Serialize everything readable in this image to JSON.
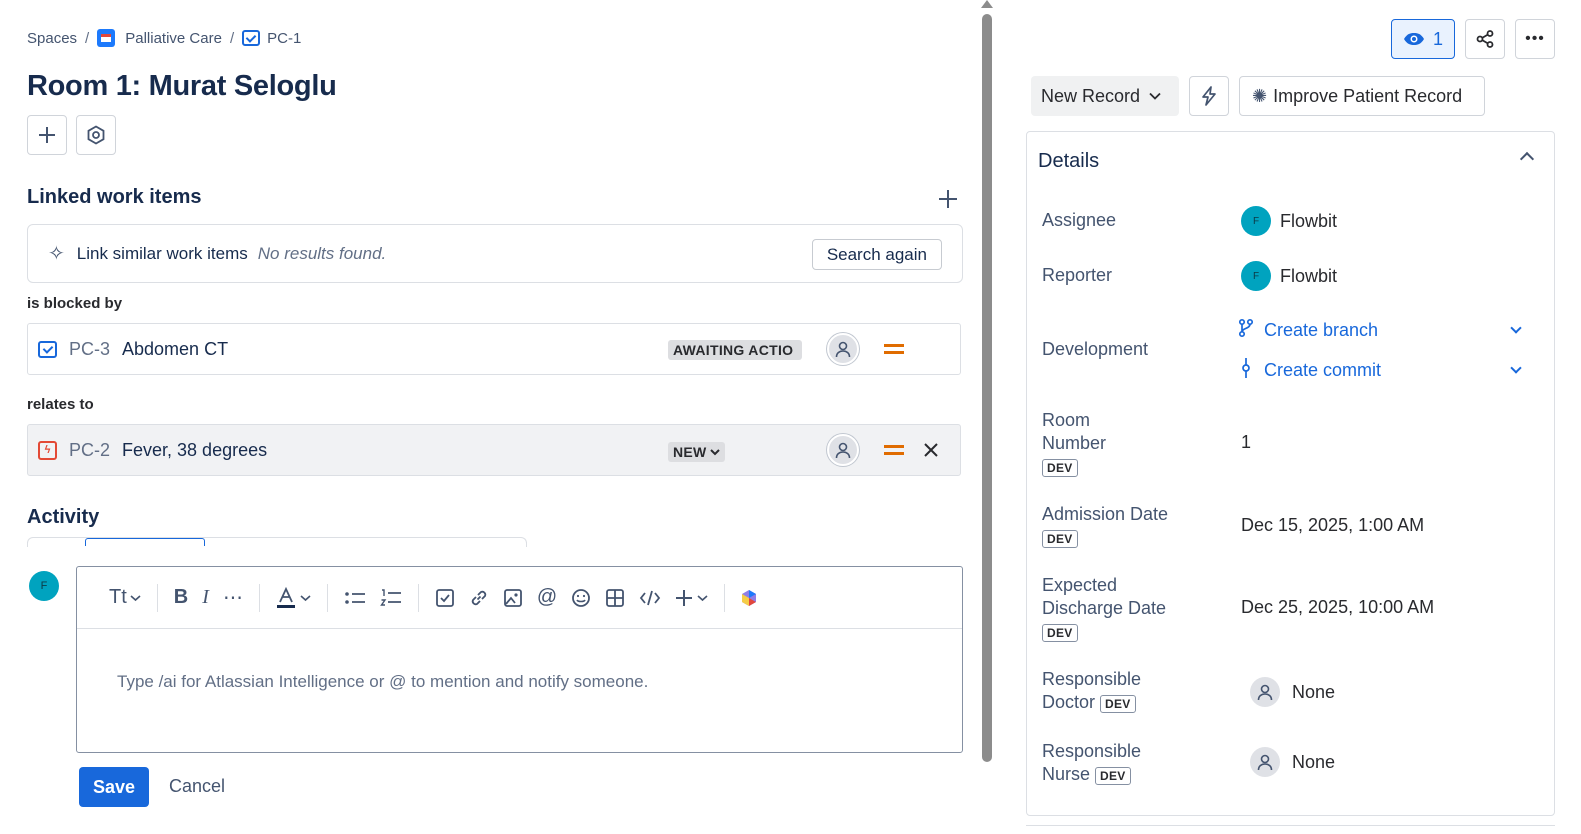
{
  "breadcrumb": {
    "spaces": "Spaces",
    "space_name": "Palliative Care",
    "issue_key": "PC-1",
    "separator": "/"
  },
  "issue": {
    "title": "Room 1: Murat Seloglu"
  },
  "linked": {
    "heading": "Linked work items",
    "suggest_label": "Link similar work items",
    "no_results": "No results found.",
    "search_again": "Search again",
    "groups": [
      {
        "relation": "is blocked by",
        "key": "PC-3",
        "summary": "Abdomen CT",
        "status": "AWAITING ACTIO"
      },
      {
        "relation": "relates to",
        "key": "PC-2",
        "summary": "Fever, 38 degrees",
        "status": "NEW"
      }
    ],
    "bug_glyph": "ϟ"
  },
  "activity": {
    "heading": "Activity",
    "avatar_initial": "F",
    "placeholder": "Type /ai for Atlassian Intelligence or @ to mention and notify someone.",
    "save": "Save",
    "cancel": "Cancel",
    "toolbar_text_style": "Tt"
  },
  "header": {
    "watch_count": "1",
    "status": "New Record",
    "improve": "Improve Patient Record"
  },
  "details": {
    "heading": "Details",
    "badge": "DEV",
    "assignee_label": "Assignee",
    "assignee": "Flowbit",
    "reporter_label": "Reporter",
    "reporter": "Flowbit",
    "user_initial": "F",
    "development_label": "Development",
    "create_branch": "Create branch",
    "create_commit": "Create commit",
    "room_label_1": "Room",
    "room_label_2": "Number",
    "room_value": "1",
    "admission_label": "Admission Date",
    "admission_value": "Dec 15, 2025, 1:00 AM",
    "discharge_label_1": "Expected",
    "discharge_label_2": "Discharge Date",
    "discharge_value": "Dec 25, 2025, 10:00 AM",
    "doctor_label_1": "Responsible",
    "doctor_label_2": "Doctor",
    "doctor_value": "None",
    "nurse_label_1": "Responsible",
    "nurse_label_2": "Nurse",
    "nurse_value": "None"
  },
  "icons": {
    "brand_color": "#1868db",
    "avatar_color": "#00a3bf",
    "priority_color": "#e06c00",
    "bug_color": "#e34935"
  }
}
